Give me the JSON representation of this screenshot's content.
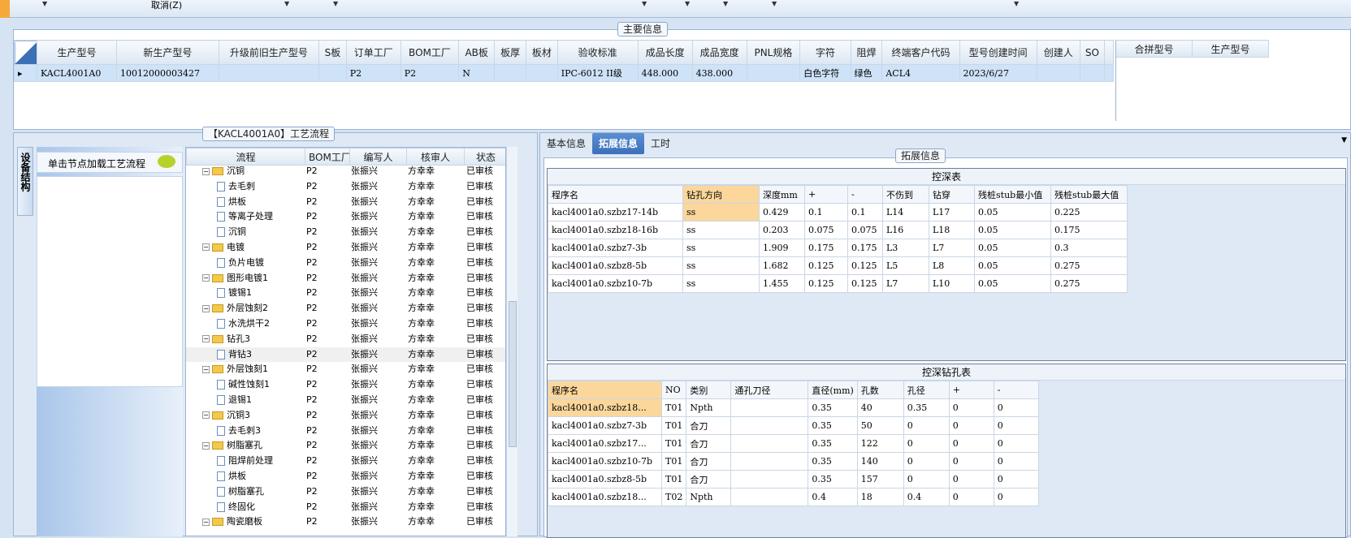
{
  "toolbar": {
    "cancel_label": "取消(Z)"
  },
  "main_info": {
    "title": "主要信息",
    "columns": [
      "生产型号",
      "新生产型号",
      "升级前旧生产型号",
      "S板",
      "订单工厂",
      "BOM工厂",
      "AB板",
      "板厚",
      "板材",
      "验收标准",
      "成品长度",
      "成品宽度",
      "PNL规格",
      "字符",
      "阻焊",
      "终端客户代码",
      "型号创建时间",
      "创建人",
      "SO"
    ],
    "row": [
      "KACL4001A0",
      "10012000003427",
      "",
      "",
      "P2",
      "P2",
      "N",
      "",
      "",
      "IPC-6012 II级",
      "448.000",
      "438.000",
      "",
      "白色字符",
      "绿色",
      "ACL4",
      "2023/6/27",
      "",
      ""
    ],
    "side_columns": [
      "合拼型号",
      "生产型号"
    ]
  },
  "process": {
    "title": "【KACL4001A0】工艺流程",
    "side_tab": "设备结构",
    "load_hint": "单击节点加载工艺流程",
    "columns": [
      "流程",
      "BOM工厂",
      "编写人",
      "核审人",
      "状态"
    ],
    "rows": [
      {
        "name": "沉铜",
        "type": "folder",
        "indent": 1,
        "bom": "P2",
        "writer": "张振兴",
        "reviewer": "方幸幸",
        "status": "已审核"
      },
      {
        "name": "去毛刺",
        "type": "doc",
        "indent": 2,
        "bom": "P2",
        "writer": "张振兴",
        "reviewer": "方幸幸",
        "status": "已审核"
      },
      {
        "name": "烘板",
        "type": "doc",
        "indent": 2,
        "bom": "P2",
        "writer": "张振兴",
        "reviewer": "方幸幸",
        "status": "已审核"
      },
      {
        "name": "等离子处理",
        "type": "doc",
        "indent": 2,
        "bom": "P2",
        "writer": "张振兴",
        "reviewer": "方幸幸",
        "status": "已审核"
      },
      {
        "name": "沉铜",
        "type": "doc",
        "indent": 2,
        "bom": "P2",
        "writer": "张振兴",
        "reviewer": "方幸幸",
        "status": "已审核"
      },
      {
        "name": "电镀",
        "type": "folder",
        "indent": 1,
        "bom": "P2",
        "writer": "张振兴",
        "reviewer": "方幸幸",
        "status": "已审核"
      },
      {
        "name": "负片电镀",
        "type": "doc",
        "indent": 2,
        "bom": "P2",
        "writer": "张振兴",
        "reviewer": "方幸幸",
        "status": "已审核"
      },
      {
        "name": "图形电镀1",
        "type": "folder",
        "indent": 1,
        "bom": "P2",
        "writer": "张振兴",
        "reviewer": "方幸幸",
        "status": "已审核"
      },
      {
        "name": "镀锡1",
        "type": "doc",
        "indent": 2,
        "bom": "P2",
        "writer": "张振兴",
        "reviewer": "方幸幸",
        "status": "已审核"
      },
      {
        "name": "外层蚀刻2",
        "type": "folder",
        "indent": 1,
        "bom": "P2",
        "writer": "张振兴",
        "reviewer": "方幸幸",
        "status": "已审核"
      },
      {
        "name": "水洗烘干2",
        "type": "doc",
        "indent": 2,
        "bom": "P2",
        "writer": "张振兴",
        "reviewer": "方幸幸",
        "status": "已审核"
      },
      {
        "name": "钻孔3",
        "type": "folder",
        "indent": 1,
        "bom": "P2",
        "writer": "张振兴",
        "reviewer": "方幸幸",
        "status": "已审核"
      },
      {
        "name": "背钻3",
        "type": "doc",
        "indent": 2,
        "bom": "P2",
        "writer": "张振兴",
        "reviewer": "方幸幸",
        "status": "已审核"
      },
      {
        "name": "外层蚀刻1",
        "type": "folder",
        "indent": 1,
        "bom": "P2",
        "writer": "张振兴",
        "reviewer": "方幸幸",
        "status": "已审核"
      },
      {
        "name": "碱性蚀刻1",
        "type": "doc",
        "indent": 2,
        "bom": "P2",
        "writer": "张振兴",
        "reviewer": "方幸幸",
        "status": "已审核"
      },
      {
        "name": "退锡1",
        "type": "doc",
        "indent": 2,
        "bom": "P2",
        "writer": "张振兴",
        "reviewer": "方幸幸",
        "status": "已审核"
      },
      {
        "name": "沉铜3",
        "type": "folder",
        "indent": 1,
        "bom": "P2",
        "writer": "张振兴",
        "reviewer": "方幸幸",
        "status": "已审核"
      },
      {
        "name": "去毛刺3",
        "type": "doc",
        "indent": 2,
        "bom": "P2",
        "writer": "张振兴",
        "reviewer": "方幸幸",
        "status": "已审核"
      },
      {
        "name": "树脂塞孔",
        "type": "folder",
        "indent": 1,
        "bom": "P2",
        "writer": "张振兴",
        "reviewer": "方幸幸",
        "status": "已审核"
      },
      {
        "name": "阻焊前处理",
        "type": "doc",
        "indent": 2,
        "bom": "P2",
        "writer": "张振兴",
        "reviewer": "方幸幸",
        "status": "已审核"
      },
      {
        "name": "烘板",
        "type": "doc",
        "indent": 2,
        "bom": "P2",
        "writer": "张振兴",
        "reviewer": "方幸幸",
        "status": "已审核"
      },
      {
        "name": "树脂塞孔",
        "type": "doc",
        "indent": 2,
        "bom": "P2",
        "writer": "张振兴",
        "reviewer": "方幸幸",
        "status": "已审核"
      },
      {
        "name": "终固化",
        "type": "doc",
        "indent": 2,
        "bom": "P2",
        "writer": "张振兴",
        "reviewer": "方幸幸",
        "status": "已审核"
      },
      {
        "name": "陶瓷磨板",
        "type": "folder",
        "indent": 1,
        "bom": "P2",
        "writer": "张振兴",
        "reviewer": "方幸幸",
        "status": "已审核"
      }
    ]
  },
  "right": {
    "tabs": [
      "基本信息",
      "拓展信息",
      "工时"
    ],
    "group_title": "拓展信息",
    "depth_table": {
      "title": "控深表",
      "columns": [
        "程序名",
        "钻孔方向",
        "深度mm",
        "+",
        "-",
        "不伤到",
        "钻穿",
        "残桩stub最小值",
        "残桩stub最大值"
      ],
      "rows": [
        [
          "kacl4001a0.szbz17-14b",
          "ss",
          "0.429",
          "0.1",
          "0.1",
          "L14",
          "L17",
          "0.05",
          "0.225"
        ],
        [
          "kacl4001a0.szbz18-16b",
          "ss",
          "0.203",
          "0.075",
          "0.075",
          "L16",
          "L18",
          "0.05",
          "0.175"
        ],
        [
          "kacl4001a0.szbz7-3b",
          "ss",
          "1.909",
          "0.175",
          "0.175",
          "L3",
          "L7",
          "0.05",
          "0.3"
        ],
        [
          "kacl4001a0.szbz8-5b",
          "ss",
          "1.682",
          "0.125",
          "0.125",
          "L5",
          "L8",
          "0.05",
          "0.275"
        ],
        [
          "kacl4001a0.szbz10-7b",
          "ss",
          "1.455",
          "0.125",
          "0.125",
          "L7",
          "L10",
          "0.05",
          "0.275"
        ]
      ]
    },
    "drill_table": {
      "title": "控深钻孔表",
      "columns": [
        "程序名",
        "NO",
        "类别",
        "通孔刀径",
        "直径(mm)",
        "孔数",
        "孔径",
        "+",
        "-"
      ],
      "rows": [
        [
          "kacl4001a0.szbz18...",
          "T01",
          "Npth",
          "",
          "0.35",
          "40",
          "0.35",
          "0",
          "0"
        ],
        [
          "kacl4001a0.szbz7-3b",
          "T01",
          "合刀",
          "",
          "0.35",
          "50",
          "0",
          "0",
          "0"
        ],
        [
          "kacl4001a0.szbz17...",
          "T01",
          "合刀",
          "",
          "0.35",
          "122",
          "0",
          "0",
          "0"
        ],
        [
          "kacl4001a0.szbz10-7b",
          "T01",
          "合刀",
          "",
          "0.35",
          "140",
          "0",
          "0",
          "0"
        ],
        [
          "kacl4001a0.szbz8-5b",
          "T01",
          "合刀",
          "",
          "0.35",
          "157",
          "0",
          "0",
          "0"
        ],
        [
          "kacl4001a0.szbz18...",
          "T02",
          "Npth",
          "",
          "0.4",
          "18",
          "0.4",
          "0",
          "0"
        ]
      ]
    }
  }
}
